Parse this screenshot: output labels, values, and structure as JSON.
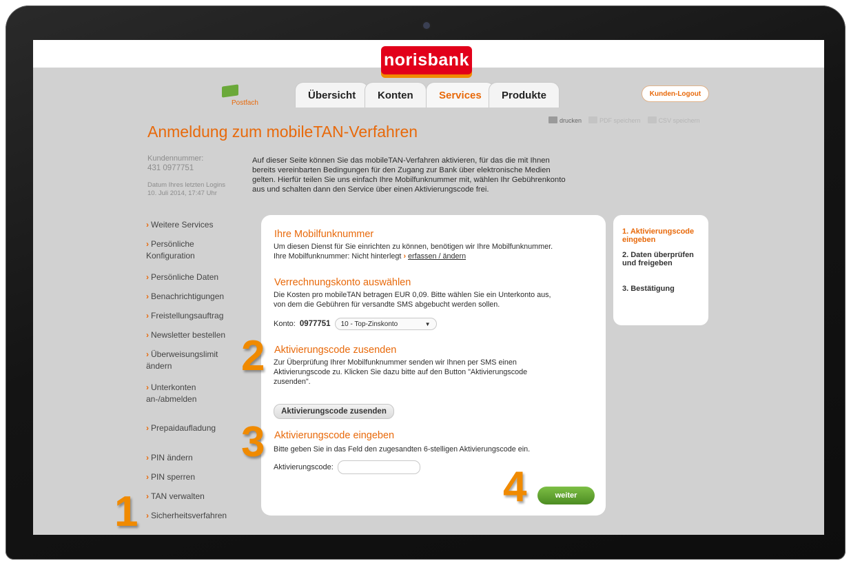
{
  "brand": {
    "logo_text": "norisbank",
    "accent": "#e8690a",
    "logo_bg": "#e2001a",
    "logo_bar": "#f08a00"
  },
  "header": {
    "postfach": "Postfach",
    "tabs": [
      {
        "label": "Übersicht"
      },
      {
        "label": "Konten"
      },
      {
        "label": "Services",
        "active": true
      },
      {
        "label": "Produkte"
      }
    ],
    "logout": "Kunden-Logout"
  },
  "tools": {
    "print": "drucken",
    "pdf": "PDF speichern",
    "csv": "CSV speichern"
  },
  "page": {
    "title": "Anmeldung zum mobileTAN-Verfahren",
    "customer_label": "Kundennummer:",
    "customer_number": "431 0977751",
    "last_login_label": "Datum Ihres letzten Logins",
    "last_login_value": "10. Juli 2014, 17:47 Uhr",
    "intro_lines": [
      "Auf dieser Seite können Sie das mobileTAN-Verfahren aktivieren, für das die mit Ihnen",
      "bereits vereinbarten Bedingungen für den Zugang zur Bank über elektronische Medien",
      "gelten. Hierfür teilen Sie uns einfach Ihre Mobilfunknummer mit, wählen Ihr Gebührenkonto",
      "aus und schalten dann den Service über einen Aktivierungscode frei."
    ]
  },
  "sidebar": {
    "items": [
      {
        "label": "Weitere Services"
      },
      {
        "label": "Persönliche Konfiguration"
      },
      {
        "label": "Persönliche Daten"
      },
      {
        "label": "Benachrichtigungen"
      },
      {
        "label": "Freistellungsauftrag"
      },
      {
        "label": "Newsletter bestellen"
      },
      {
        "label": "Überweisungslimit ändern"
      },
      {
        "label": "Unterkonten an-/abmelden"
      },
      {
        "label": "Prepaidaufladung"
      },
      {
        "label": "PIN ändern"
      },
      {
        "label": "PIN sperren"
      },
      {
        "label": "TAN verwalten"
      },
      {
        "label": "Sicherheitsverfahren"
      }
    ]
  },
  "form": {
    "mobile": {
      "heading": "Ihre Mobilfunknummer",
      "text": "Um diesen Dienst für Sie einrichten zu können, benötigen wir Ihre Mobilfunknummer.",
      "status": "Ihre Mobilfunknummer: Nicht hinterlegt",
      "link": "erfassen / ändern"
    },
    "account": {
      "heading": "Verrechnungskonto auswählen",
      "text_lines": [
        "Die Kosten pro mobileTAN betragen EUR 0,09. Bitte wählen Sie ein Unterkonto aus,",
        "von dem die Gebühren für versandte SMS abgebucht werden sollen."
      ],
      "konto_label": "Konto:",
      "konto_number": "0977751",
      "select_value": "10 - Top-Zinskonto"
    },
    "send": {
      "heading": "Aktivierungscode zusenden",
      "text_lines": [
        "Zur Überprüfung Ihrer Mobilfunknummer senden wir Ihnen per SMS einen",
        "Aktivierungscode zu. Klicken Sie dazu bitte auf den Button \"Aktivierungscode",
        "zusenden\"."
      ],
      "button": "Aktivierungscode zusenden"
    },
    "enter": {
      "heading": "Aktivierungscode eingeben",
      "text": "Bitte geben Sie in das Feld den zugesandten 6-stelligen Aktivierungscode ein.",
      "field_label": "Aktivierungscode:",
      "field_value": ""
    },
    "submit": "weiter"
  },
  "steps": [
    {
      "label": "1. Aktivierungscode eingeben",
      "current": true
    },
    {
      "label": "2. Daten überprüfen und freigeben"
    },
    {
      "label": "3. Bestätigung"
    }
  ],
  "overlay_numbers": [
    "1",
    "2",
    "3",
    "4"
  ]
}
